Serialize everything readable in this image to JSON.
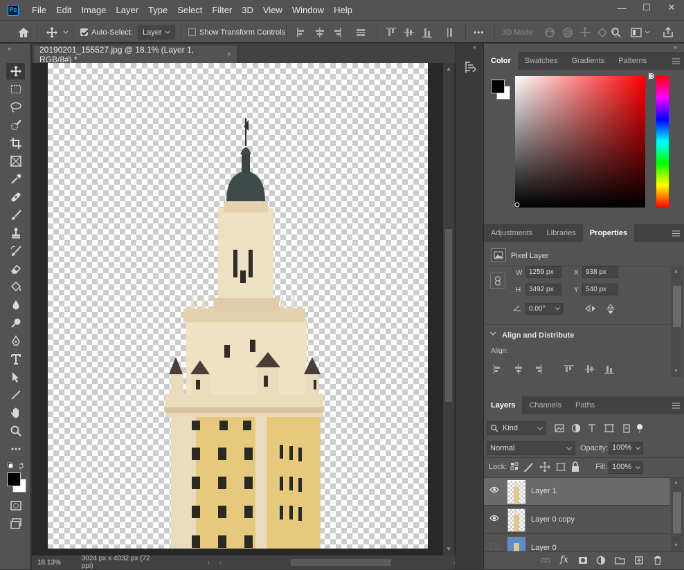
{
  "app": {
    "logo": "Ps"
  },
  "menu": [
    "File",
    "Edit",
    "Image",
    "Layer",
    "Type",
    "Select",
    "Filter",
    "3D",
    "View",
    "Window",
    "Help"
  ],
  "window_controls": {
    "minimize": "—",
    "maximize": "☐",
    "close": "✕"
  },
  "options": {
    "auto_select_label": "Auto-Select:",
    "auto_select_checked": true,
    "auto_select_target": "Layer",
    "show_transform_label": "Show Transform Controls",
    "show_transform_checked": false,
    "mode_3d_label": "3D Mode:",
    "more_label": "•••"
  },
  "document": {
    "tab_title": "20190201_155527.jpg @ 18.1% (Layer 1, RGB/8#) *",
    "zoom": "18.13%",
    "doc_info": "3024 px x 4032 px (72 ppi)"
  },
  "color_panel": {
    "tabs": [
      "Color",
      "Swatches",
      "Gradients",
      "Patterns"
    ],
    "active_tab": "Color",
    "foreground": "#000000",
    "background": "#ffffff",
    "picker_hue": "#ff0000"
  },
  "properties_panel": {
    "tabs": [
      "Adjustments",
      "Libraries",
      "Properties"
    ],
    "active_tab": "Properties",
    "layer_kind": "Pixel Layer",
    "w_label": "W",
    "w_value": "1259 px",
    "h_label": "H",
    "h_value": "3492 px",
    "x_label": "X",
    "x_value": "938 px",
    "y_label": "Y",
    "y_value": "540 px",
    "angle_value": "0.00°",
    "align_section": "Align and Distribute",
    "align_label": "Align:"
  },
  "layers_panel": {
    "tabs": [
      "Layers",
      "Channels",
      "Paths"
    ],
    "active_tab": "Layers",
    "filter_kind": "Kind",
    "blend_mode": "Normal",
    "opacity_label": "Opacity:",
    "opacity_value": "100%",
    "lock_label": "Lock:",
    "fill_label": "Fill:",
    "fill_value": "100%",
    "layers": [
      {
        "name": "Layer 1",
        "visible": true,
        "selected": true
      },
      {
        "name": "Layer 0 copy",
        "visible": true,
        "selected": false
      },
      {
        "name": "Layer 0",
        "visible": false,
        "selected": false
      }
    ],
    "fx_label": "fx"
  },
  "colors": {
    "accent": "#31a8ff",
    "panel": "#535353",
    "dark": "#424242",
    "canvas_bg": "#282828"
  }
}
